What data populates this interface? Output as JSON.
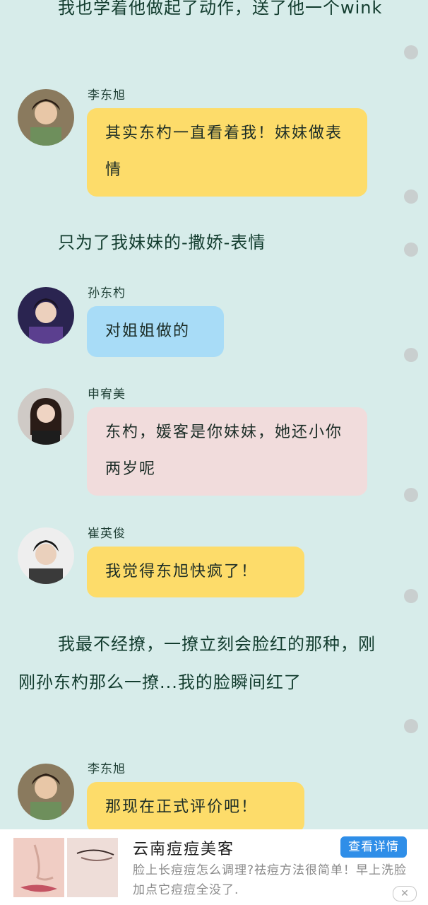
{
  "narration": [
    "我也学着他做起了动作，送了他一个wink",
    "只为了我妹妹的-撒娇-表情",
    "我最不经撩，一撩立刻会脸红的那种，刚刚孙东杓那么一撩...我的脸瞬间红了"
  ],
  "messages": [
    {
      "speaker": "李东旭",
      "text": "其实东杓一直看着我！妹妹做表情",
      "avatar_icon": "li-donghyuk-avatar",
      "color": "yellow"
    },
    {
      "speaker": "孙东杓",
      "text": "对姐姐做的",
      "avatar_icon": "son-dongpyo-avatar",
      "color": "blue"
    },
    {
      "speaker": "申宥美",
      "text": "东杓，媛客是你妹妹，她还小你两岁呢",
      "avatar_icon": "shin-yumi-avatar",
      "color": "pink"
    },
    {
      "speaker": "崔英俊",
      "text": "我觉得东旭快疯了！",
      "avatar_icon": "choi-youngjun-avatar",
      "color": "yellow"
    },
    {
      "speaker": "李东旭",
      "text": "那现在正式评价吧！",
      "avatar_icon": "li-donghyuk-avatar",
      "color": "yellow"
    }
  ],
  "colors": {
    "background": "#d7ecea",
    "bubble_yellow": "#fddc6a",
    "bubble_blue": "#a8dcf7",
    "bubble_pink": "#f1dcdc",
    "ad_button": "#2f8ee8"
  },
  "ad": {
    "title": "云南痘痘美客",
    "button": "查看详情",
    "description": "脸上长痘痘怎么调理?祛痘方法很简单！早上洗脸加点它痘痘全没了.",
    "close_icon": "close-icon",
    "close_symbol": "✕"
  }
}
